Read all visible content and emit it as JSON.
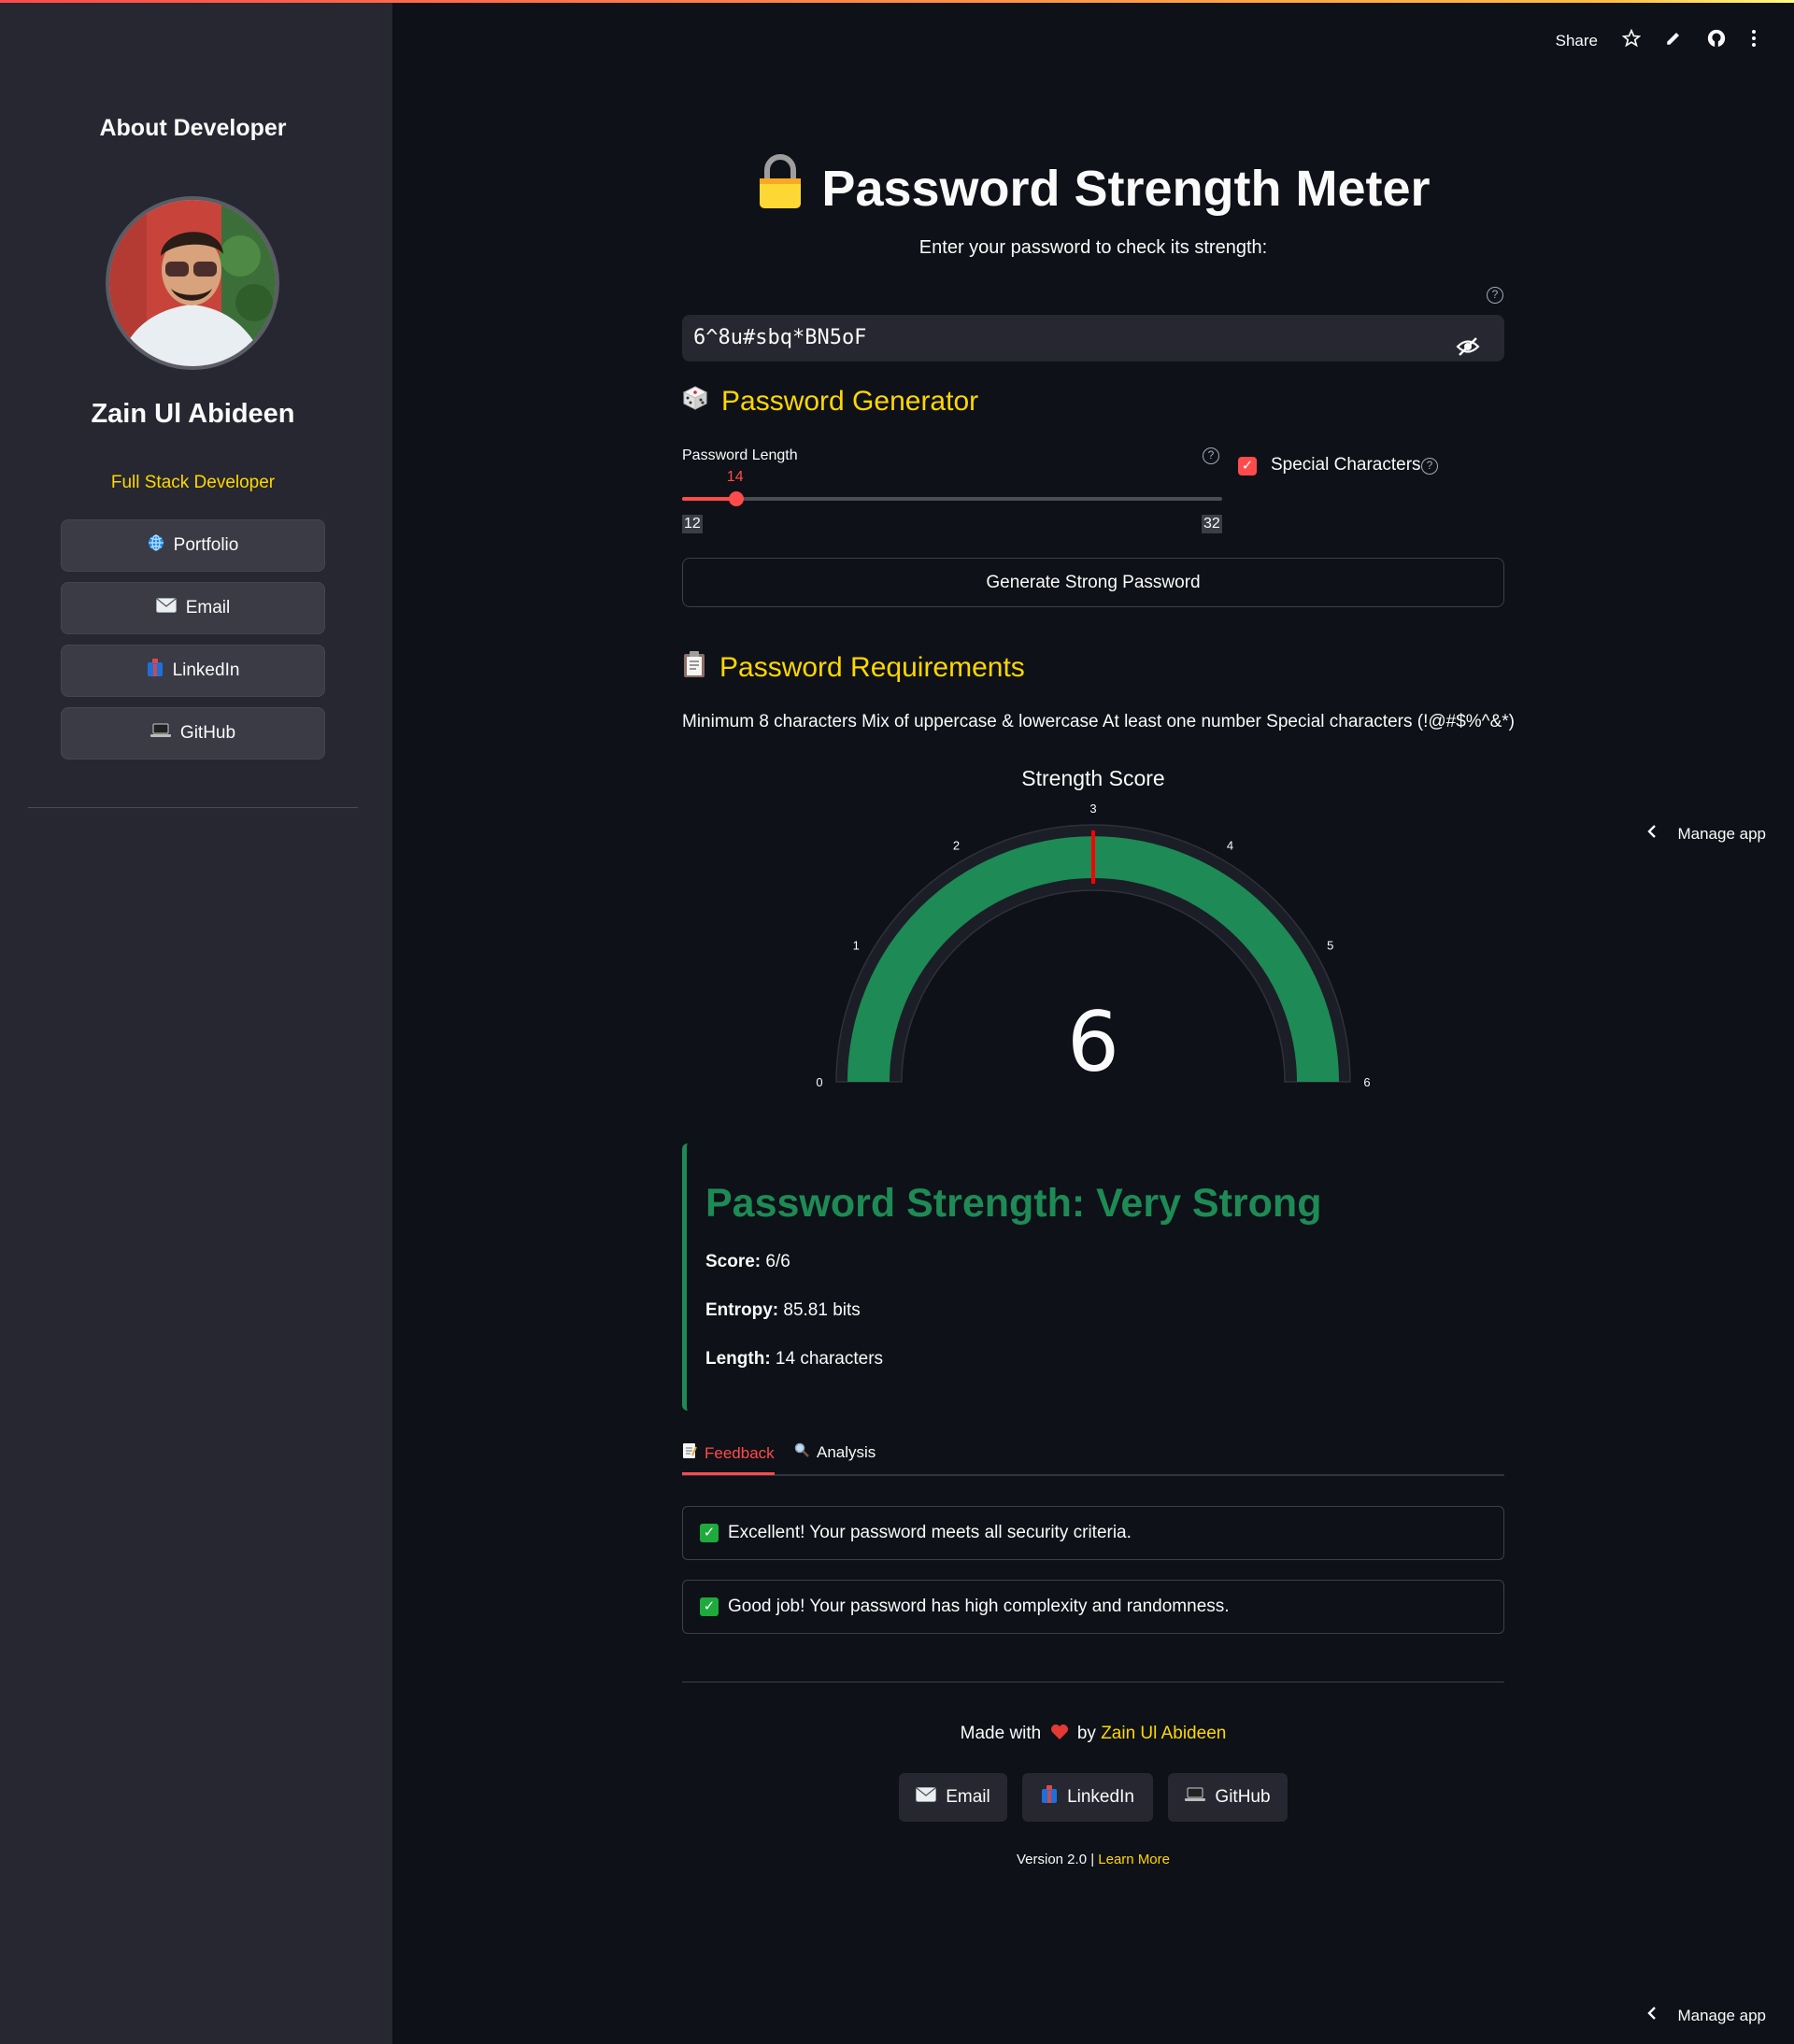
{
  "sidebar": {
    "title": "About Developer",
    "name": "Zain Ul Abideen",
    "role": "Full Stack Developer",
    "buttons": [
      {
        "label": "Portfolio",
        "icon": "globe-icon"
      },
      {
        "label": "Email",
        "icon": "envelope-icon"
      },
      {
        "label": "LinkedIn",
        "icon": "linkedin-icon"
      },
      {
        "label": "GitHub",
        "icon": "laptop-icon"
      }
    ]
  },
  "toolbar": {
    "share_label": "Share",
    "manage_app_label": "Manage app"
  },
  "main": {
    "title": "Password Strength Meter",
    "subtitle": "Enter your password to check its strength:",
    "password_value": "6^8u#sbq*BN5oF",
    "generator": {
      "heading": "Password Generator",
      "length_label": "Password Length",
      "length_value": "14",
      "length_min": "12",
      "length_max": "32",
      "special_chars_label": "Special Characters",
      "special_chars_checked": true,
      "button_label": "Generate Strong Password"
    },
    "requirements": {
      "heading": "Password Requirements",
      "text": "Minimum 8 characters Mix of uppercase & lowercase At least one number Special characters (!@#$%^&*)"
    },
    "result": {
      "heading": "Password Strength: Very Strong",
      "score_label": "Score:",
      "score_value": " 6/6",
      "entropy_label": "Entropy:",
      "entropy_value": " 85.81 bits",
      "length_label": "Length:",
      "length_value": " 14 characters"
    },
    "tabs": [
      {
        "label": "Feedback",
        "active": true
      },
      {
        "label": "Analysis",
        "active": false
      }
    ],
    "feedback": [
      "Excellent! Your password meets all security criteria.",
      "Good job! Your password has high complexity and randomness."
    ],
    "footer": {
      "made_with": "Made with",
      "by": "by",
      "author": "Zain Ul Abideen",
      "buttons": [
        "Email",
        "LinkedIn",
        "GitHub"
      ],
      "version": "Version 2.0 |",
      "learn_more": "Learn More"
    }
  },
  "colors": {
    "accent": "#ff4b4b",
    "heading": "#ffd700",
    "success": "#1e8a55"
  },
  "chart_data": {
    "type": "gauge",
    "title": "Strength Score",
    "value": 6,
    "min": 0,
    "max": 6,
    "tick_labels": [
      "0",
      "1",
      "2",
      "3",
      "4",
      "5",
      "6"
    ],
    "threshold": 3,
    "bar_color": "#1e8a55",
    "threshold_color": "#ff0000"
  }
}
